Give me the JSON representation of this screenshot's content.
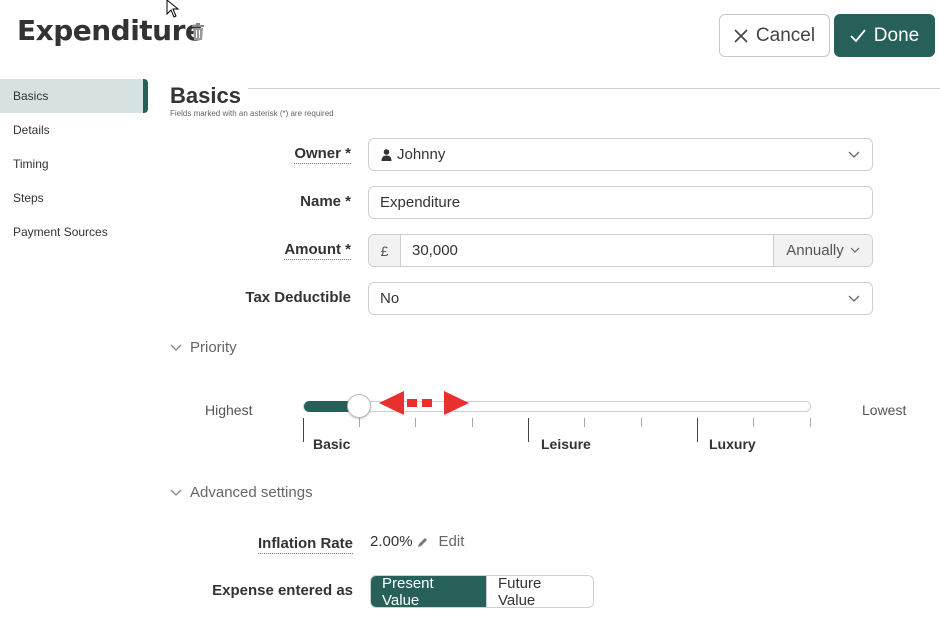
{
  "header": {
    "title": "Expenditure",
    "cancel_label": "Cancel",
    "done_label": "Done"
  },
  "sidebar": {
    "items": [
      {
        "label": "Basics",
        "active": true
      },
      {
        "label": "Details"
      },
      {
        "label": "Timing"
      },
      {
        "label": "Steps"
      },
      {
        "label": "Payment Sources"
      }
    ]
  },
  "section": {
    "title": "Basics",
    "note": "Fields marked with an asterisk (*) are required"
  },
  "form": {
    "owner": {
      "label": "Owner *",
      "value": "Johnny"
    },
    "name": {
      "label": "Name *",
      "value": "Expenditure"
    },
    "amount": {
      "label": "Amount *",
      "currency": "£",
      "value": "30,000",
      "frequency": "Annually"
    },
    "tax": {
      "label": "Tax Deductible",
      "value": "No"
    }
  },
  "priority": {
    "label": "Priority",
    "highest": "Highest",
    "lowest": "Lowest",
    "level_fraction": 0.11,
    "ticks": [
      "Basic",
      "Leisure",
      "Luxury"
    ]
  },
  "advanced": {
    "label": "Advanced settings",
    "inflation_label": "Inflation Rate",
    "inflation_value": "2.00%",
    "edit_label": "Edit",
    "expense_label": "Expense entered as",
    "present_label": "Present Value",
    "future_label": "Future Value"
  },
  "colors": {
    "accent": "#266059",
    "arrow": "#e8302e"
  }
}
